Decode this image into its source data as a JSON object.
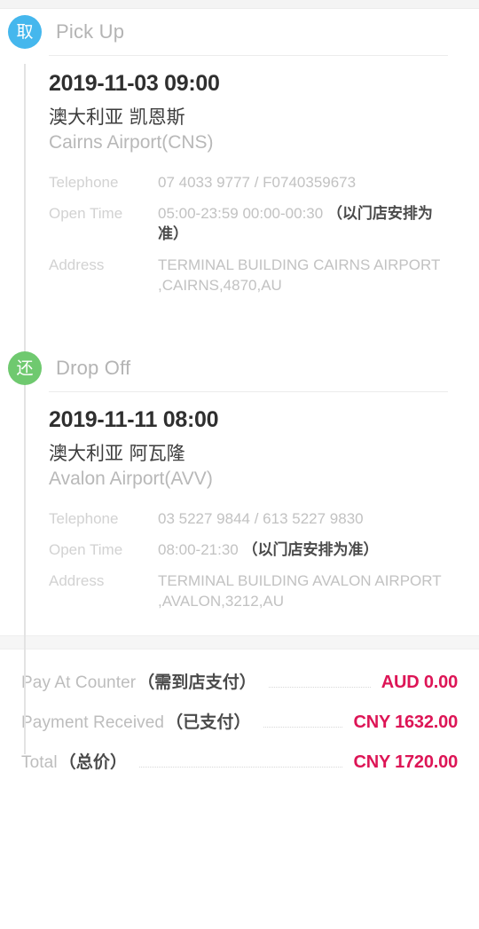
{
  "theme": {
    "pickup_badge_color": "#45b7ed",
    "dropoff_badge_color": "#6fc96f",
    "amount_color": "#dd1556",
    "rail_color": "#e3e3e3"
  },
  "legs": [
    {
      "badge_glyph": "取",
      "title": "Pick Up",
      "datetime": "2019-11-03 09:00",
      "city": "澳大利亚 凯恩斯",
      "station": "Cairns Airport(CNS)",
      "info": [
        {
          "label": "Telephone",
          "value": "07 4033 9777 / F0740359673",
          "note": ""
        },
        {
          "label": "Open Time",
          "value": "05:00-23:59 00:00-00:30 ",
          "note": "（以门店安排为准）"
        },
        {
          "label": "Address",
          "value": "TERMINAL BUILDING CAIRNS AIRPORT ,CAIRNS,4870,AU",
          "note": ""
        }
      ]
    },
    {
      "badge_glyph": "还",
      "title": "Drop Off",
      "datetime": "2019-11-11 08:00",
      "city": "澳大利亚 阿瓦隆",
      "station": "Avalon Airport(AVV)",
      "info": [
        {
          "label": "Telephone",
          "value": "03 5227 9844 / 613 5227 9830",
          "note": ""
        },
        {
          "label": "Open Time",
          "value": "08:00-21:30 ",
          "note": "（以门店安排为准）"
        },
        {
          "label": "Address",
          "value": "TERMINAL BUILDING AVALON AIRPORT ,AVALON,3212,AU",
          "note": ""
        }
      ]
    }
  ],
  "payments": [
    {
      "label_en": "Pay At Counter",
      "label_cn": "（需到店支付）",
      "amount": "AUD 0.00"
    },
    {
      "label_en": "Payment Received",
      "label_cn": "（已支付）",
      "amount": "CNY 1632.00"
    },
    {
      "label_en": "Total",
      "label_cn": "（总价）",
      "amount": "CNY 1720.00"
    }
  ]
}
